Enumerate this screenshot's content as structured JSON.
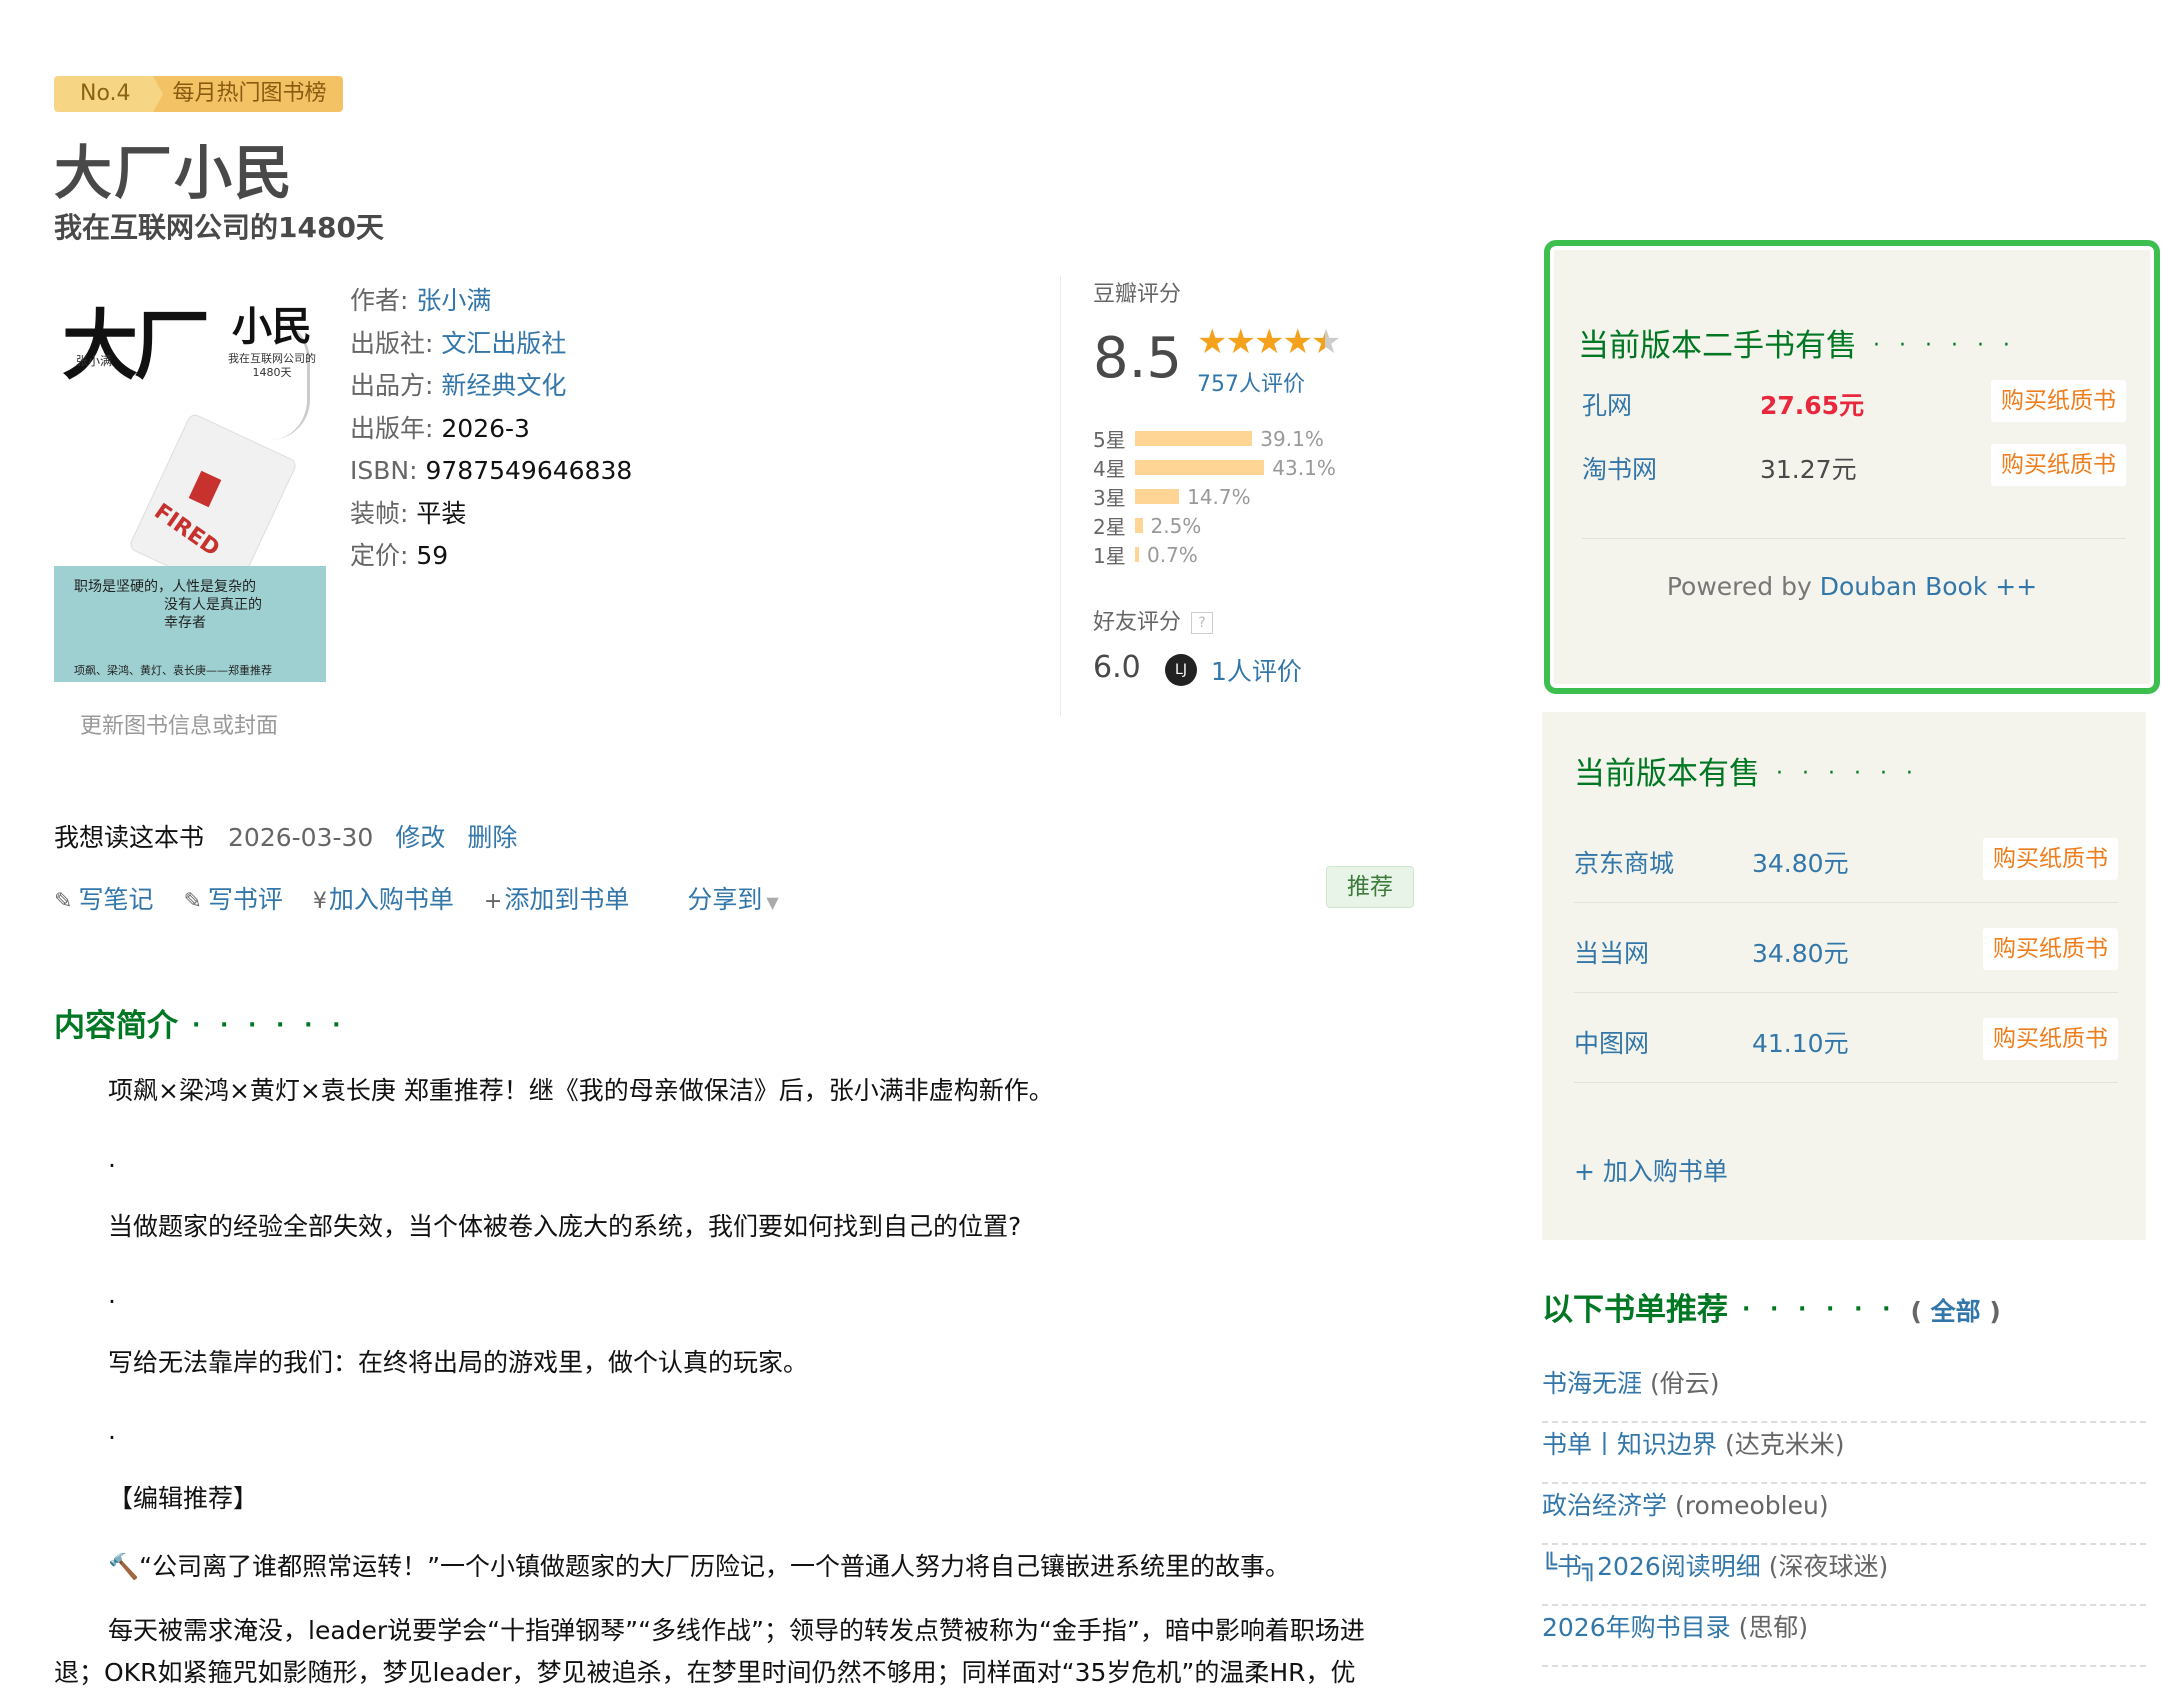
{
  "rank": {
    "no": "No.4",
    "name": "每月热门图书榜"
  },
  "book": {
    "title": "大厂小民",
    "subtitle": "我在互联网公司的1480天",
    "cover_text": {
      "title_big": "大厂",
      "title_small": "小民",
      "author": "张小满",
      "sub": "我在互联网公司的1480天",
      "fired": "FIRED",
      "band_line1": "职场是坚硬的，人性是复杂的",
      "band_line2": "没有人是真正的幸存者",
      "band_line3": "项飙、梁鸿、黄灯、袁长庚——郑重推荐"
    },
    "update_cover": "更新图书信息或封面"
  },
  "info": {
    "author_label": "作者:",
    "author": "张小满",
    "publisher_label": "出版社:",
    "publisher": "文汇出版社",
    "producer_label": "出品方:",
    "producer": "新经典文化",
    "year_label": "出版年:",
    "year": "2026-3",
    "isbn_label": "ISBN:",
    "isbn": "9787549646838",
    "binding_label": "装帧:",
    "binding": "平装",
    "price_label": "定价:",
    "price": "59"
  },
  "rating": {
    "label": "豆瓣评分",
    "score": "8.5",
    "stars": "★★★★",
    "half_star": "★",
    "count": "757人评价",
    "distribution": [
      {
        "label": "5星",
        "pct": "39.1%",
        "value": 39.1
      },
      {
        "label": "4星",
        "pct": "43.1%",
        "value": 43.1
      },
      {
        "label": "3星",
        "pct": "14.7%",
        "value": 14.7
      },
      {
        "label": "2星",
        "pct": "2.5%",
        "value": 2.5
      },
      {
        "label": "1星",
        "pct": "0.7%",
        "value": 0.7
      }
    ],
    "friend_label": "好友评分",
    "friend_help": "?",
    "friend_score": "6.0",
    "friend_avatar": "LJ",
    "friend_count": "1人评价"
  },
  "interest": {
    "status": "我想读这本书",
    "date": "2026-03-30",
    "edit": "修改",
    "delete": "删除"
  },
  "actions": {
    "note": "写笔记",
    "review": "写书评",
    "cart": "加入购书单",
    "booklist": "添加到书单",
    "share": "分享到",
    "recommend": "推荐"
  },
  "intro": {
    "title": "内容简介",
    "dots": "· · · · · ·",
    "p1": "项飙×梁鸿×黄灯×袁长庚 郑重推荐！继《我的母亲做保洁》后，张小满非虚构新作。",
    "dot": ".",
    "p2": "当做题家的经验全部失效，当个体被卷入庞大的系统，我们要如何找到自己的位置?",
    "p3": "写给无法靠岸的我们：在终将出局的游戏里，做个认真的玩家。",
    "p4": "【编辑推荐】",
    "p5": "🔨“公司离了谁都照常运转！”一个小镇做题家的大厂历险记，一个普通人努力将自己镶嵌进系统里的故事。",
    "p6": "每天被需求淹没，leader说要学会“十指弹钢琴”“多线作战”；领导的转发点赞被称为“金手指”，暗中影响着职场进",
    "p7": "退；OKR如紧箍咒如影随形，梦见leader，梦见被追杀，在梦里时间仍然不够用；同样面对“35岁危机”的温柔HR，优"
  },
  "secondhand": {
    "title": "当前版本二手书有售",
    "dots": "· · · · · ·",
    "vendors": [
      {
        "name": "孔网",
        "price": "27.65元",
        "button": "购买纸质书"
      },
      {
        "name": "淘书网",
        "price": "31.27元",
        "button": "购买纸质书"
      }
    ],
    "powered_prefix": "Powered by ",
    "powered_link": "Douban Book ++"
  },
  "onsale": {
    "title": "当前版本有售",
    "dots": "· · · · · ·",
    "vendors": [
      {
        "name": "京东商城",
        "price": "34.80元",
        "button": "购买纸质书"
      },
      {
        "name": "当当网",
        "price": "34.80元",
        "button": "购买纸质书"
      },
      {
        "name": "中图网",
        "price": "41.10元",
        "button": "购买纸质书"
      }
    ],
    "add_to_cart": "+ 加入购书单"
  },
  "booklists": {
    "title": "以下书单推荐",
    "dots": "· · · · · ·",
    "all_open": "(",
    "all": "全部",
    "all_close": ")",
    "items": [
      {
        "name": "书海无涯",
        "owner": "(佾云)"
      },
      {
        "name": "书单丨知识边界",
        "owner": "(达克米米)"
      },
      {
        "name": "政治经济学",
        "owner": "(romeobleu)"
      },
      {
        "name": "╚书╗2026阅读明细",
        "owner": "(深夜球迷)"
      },
      {
        "name": "2026年购书目录",
        "owner": "(思郁)"
      }
    ]
  }
}
